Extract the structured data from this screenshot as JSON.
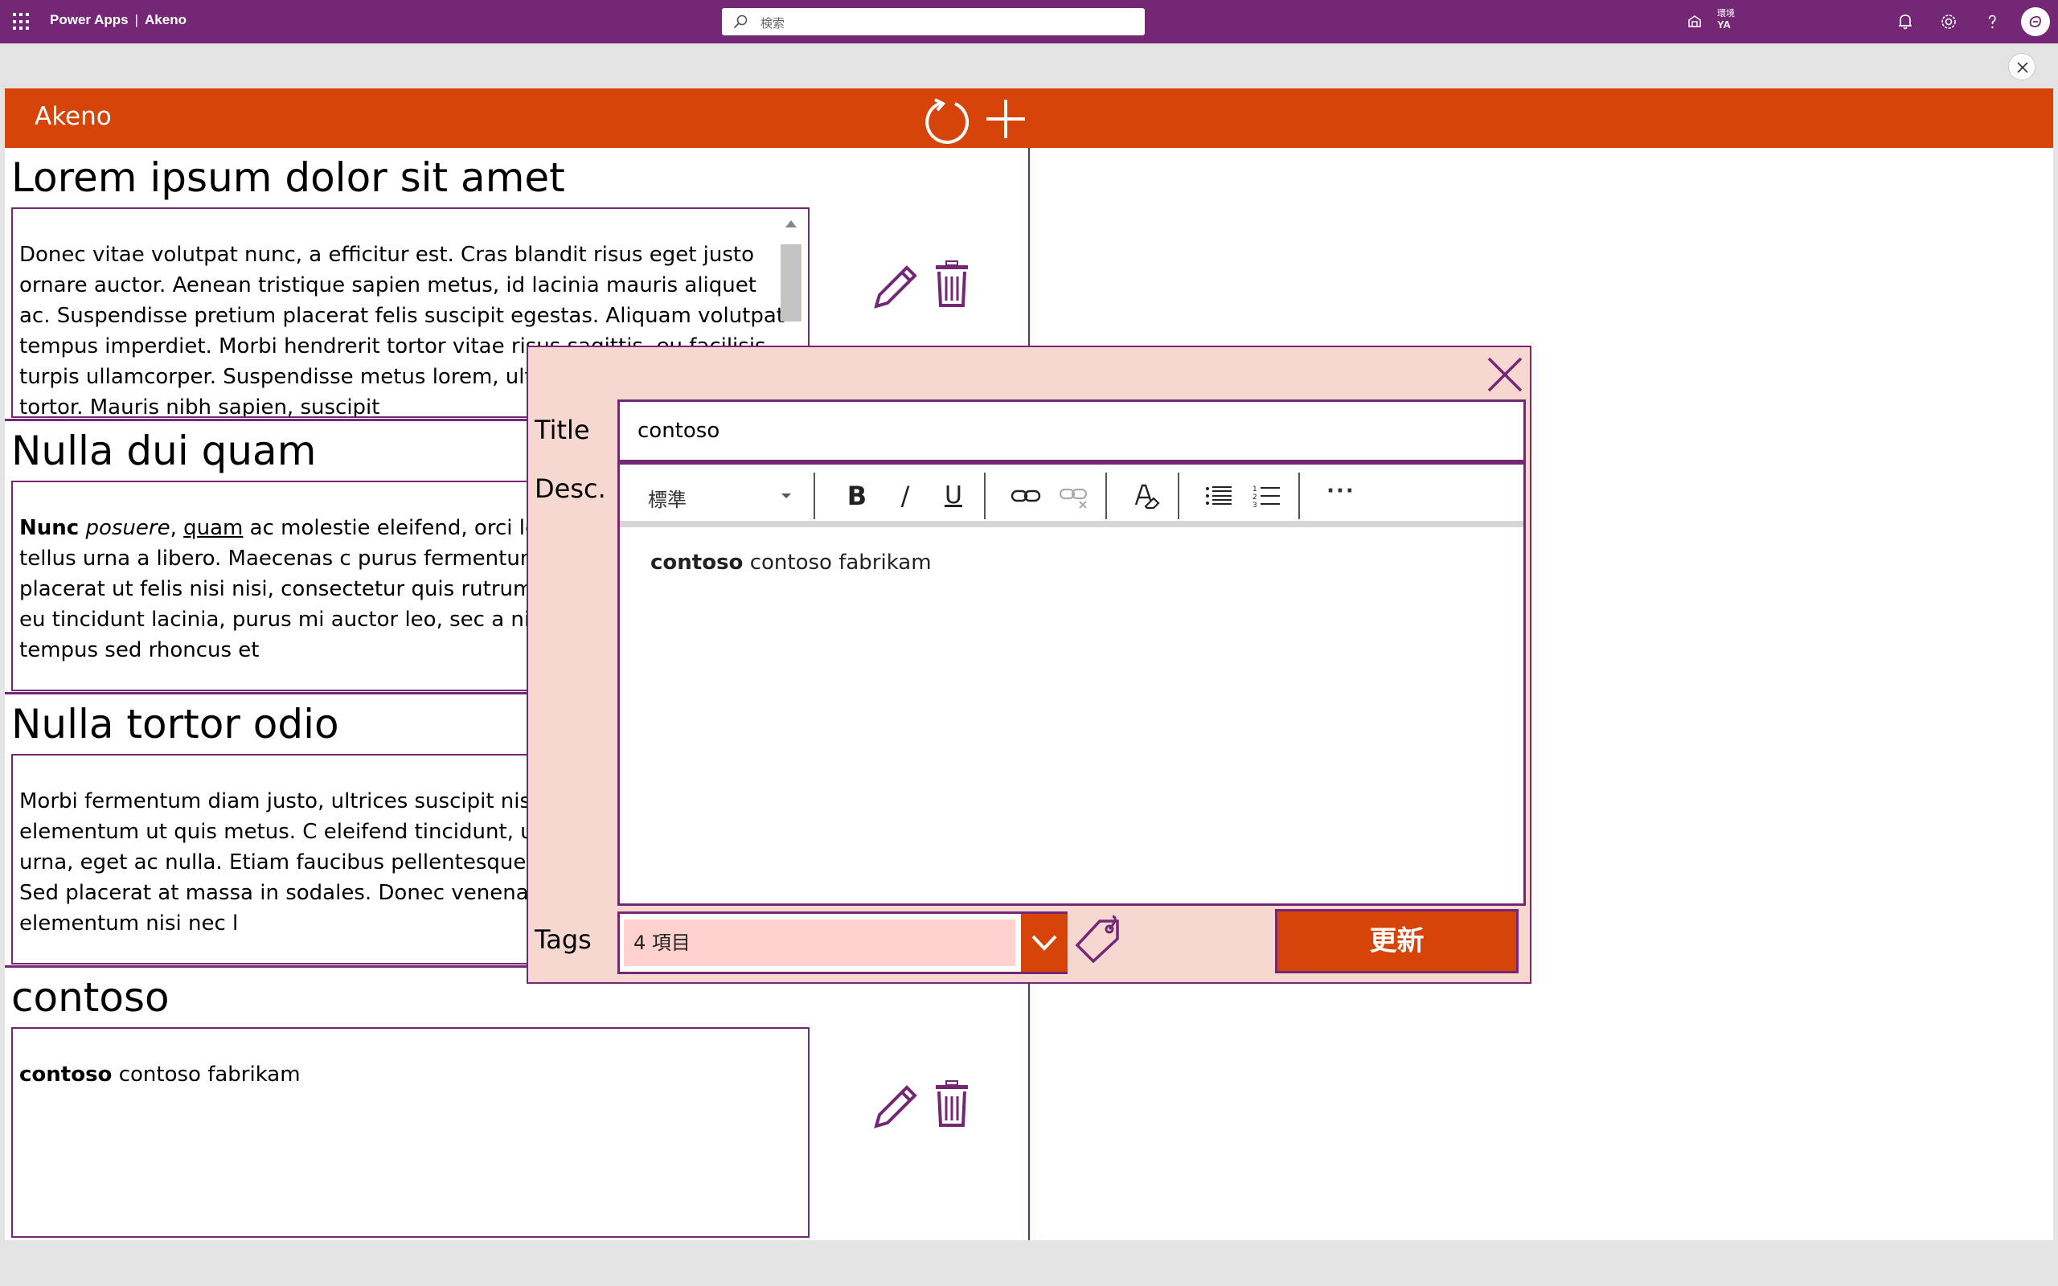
{
  "topbar": {
    "app_name": "Power Apps",
    "separator": "|",
    "app_title": "Akeno",
    "search_placeholder": "検索",
    "environment_label": "環境",
    "environment_name": "YA",
    "colors": {
      "background": "#742774",
      "text": "#ffffff"
    }
  },
  "app": {
    "header_title": "Akeno",
    "colors": {
      "header": "#d64409",
      "border": "#742774",
      "dialog_bg": "#f6d8d1"
    },
    "items": [
      {
        "title": "Lorem ipsum dolor sit amet",
        "body": "Donec vitae volutpat nunc, a efficitur est. Cras blandit risus eget justo ornare auctor. Aenean tristique sapien metus, id lacinia mauris aliquet ac. Suspendisse pretium placerat felis suscipit egestas. Aliquam volutpat tempus imperdiet. Morbi hendrerit tortor vitae risus sagittis, eu facilisis turpis ullamcorper. Suspendisse metus lorem, ultrices at elementum ut tortor. Mauris nibh sapien, suscipit"
      },
      {
        "title": "Nulla dui quam",
        "body_bold": "Nunc",
        "body_italic": "posuere",
        "body_comma": ",",
        "body_underline": "quam",
        "body_rest": "ac molestie eleifend, orci leo dignissim facilisis tellus urna a libero. Maecenas c purus fermentum suscipit. Donec placerat ut felis nisi nisi, consectetur quis rutrum vel, pulvinar a er turpis eu tincidunt lacinia, purus mi auctor leo, sec a nisi. Maecenas mi nunc, tempus sed rhoncus et"
      },
      {
        "title": "Nulla tortor odio",
        "body": "Morbi fermentum diam justo, ultrices suscipit nisi quis tortor commodo elementum ut quis metus. C eleifend tincidunt, urna ligula hendrerit urna, eget ac nulla. Etiam faucibus pellentesque ex ac ultricie tristique. Sed placerat at massa in sodales. Donec venenatis pharetra. Quisque elementum nisi nec l"
      },
      {
        "title": "contoso",
        "body_bold": "contoso",
        "body_rest": "contoso fabrikam"
      }
    ]
  },
  "dialog": {
    "title_label": "Title",
    "title_value": "contoso",
    "desc_label": "Desc.",
    "rte": {
      "style_select": "標準",
      "bold": "B",
      "italic": "/",
      "underline": "U",
      "more": "···",
      "content_bold": "contoso",
      "content_rest": "contoso fabrikam"
    },
    "tags_label": "Tags",
    "tags_value": "4 項目",
    "update_label": "更新"
  }
}
